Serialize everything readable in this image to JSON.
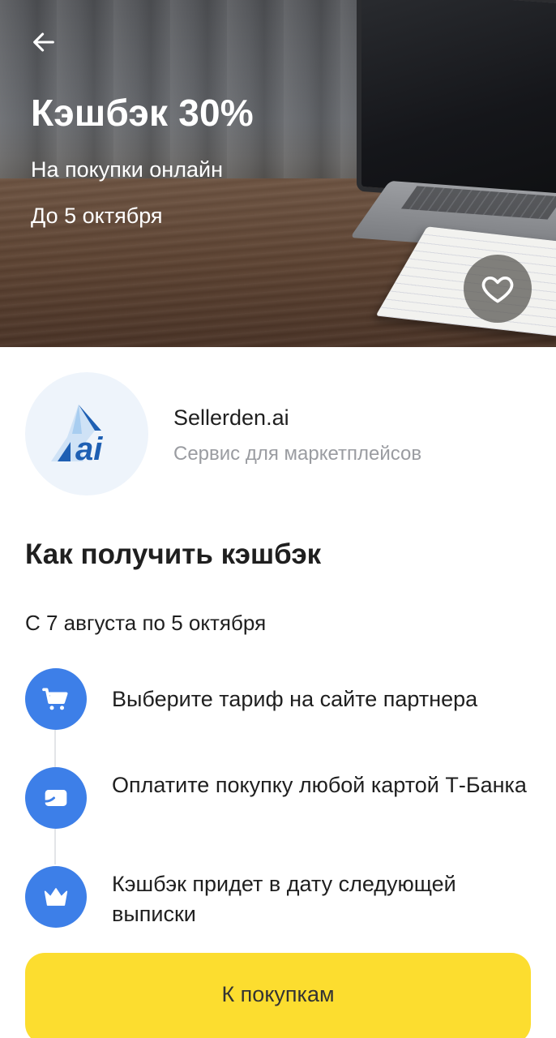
{
  "hero": {
    "title": "Кэшбэк 30%",
    "subtitle": "На покупки онлайн",
    "date": "До 5 октября"
  },
  "icons": {
    "back": "arrow-left-icon",
    "favorite": "heart-icon",
    "step1": "cart-icon",
    "step2": "card-icon",
    "step3": "crown-icon"
  },
  "partner": {
    "name": "Sellerden.ai",
    "description": "Сервис для маркетплейсов",
    "logo_text": "ai"
  },
  "how_to": {
    "title": "Как получить кэшбэк",
    "period": "С 7 августа по 5 октября",
    "steps": [
      {
        "text": "Выберите тариф на сайте партнера"
      },
      {
        "text": "Оплатите покупку любой картой Т-Банка"
      },
      {
        "text": "Кэшбэк придет в дату следующей выписки"
      }
    ]
  },
  "cta": {
    "label": "К покупкам"
  },
  "colors": {
    "accent_yellow": "#fcdd2f",
    "step_blue": "#3d7fe8",
    "muted_text": "#9a9ca1",
    "logo_blue": "#1e5fb3"
  }
}
